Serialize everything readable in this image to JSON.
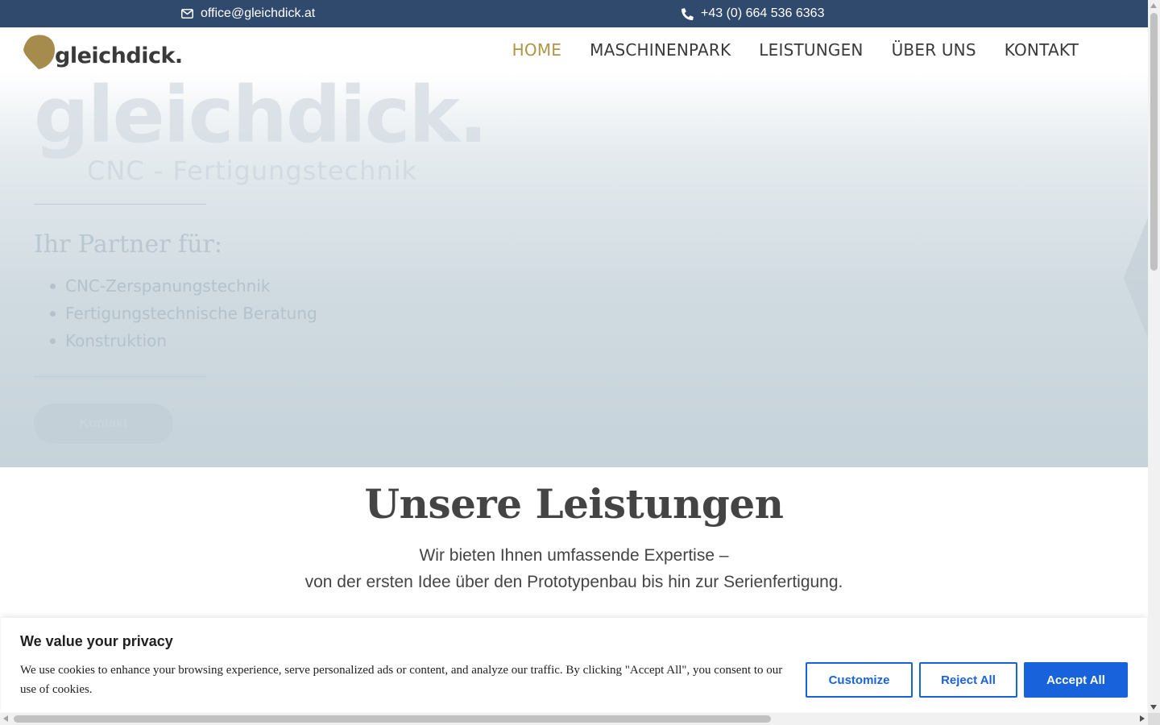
{
  "topbar": {
    "email": "office@gleichdick.at",
    "phone": "+43 (0) 664 536 6363",
    "background": "#304a6e"
  },
  "logo": {
    "text": "gleichdick.",
    "accent": "#b09447"
  },
  "nav": {
    "items": [
      {
        "label": "HOME",
        "active": true
      },
      {
        "label": "MASCHINENPARK",
        "active": false
      },
      {
        "label": "LEISTUNGEN",
        "active": false
      },
      {
        "label": "ÜBER UNS",
        "active": false
      },
      {
        "label": "KONTAKT",
        "active": false
      }
    ],
    "active_color": "#b09447"
  },
  "hero": {
    "title": "gleichdick.",
    "subtitle": "CNC - Fertigungstechnik",
    "partner_heading": "Ihr Partner für:",
    "list": [
      "CNC-Zerspanungstechnik",
      "Fertigungstechnische Beratung",
      "Konstruktion"
    ],
    "button": "Kontakt"
  },
  "services": {
    "title": "Unsere Leistungen",
    "line1": "Wir bieten Ihnen umfassende Expertise –",
    "line2": "von der ersten Idee über den Prototypenbau bis hin zur Serienfertigung."
  },
  "cookie": {
    "title": "We value your privacy",
    "text": "We use cookies to enhance your browsing experience, serve personalized ads or content, and analyze our traffic. By clicking \"Accept All\", you consent to our use of cookies.",
    "customize": "Customize",
    "reject": "Reject All",
    "accept": "Accept All",
    "accent": "#1863dc"
  }
}
